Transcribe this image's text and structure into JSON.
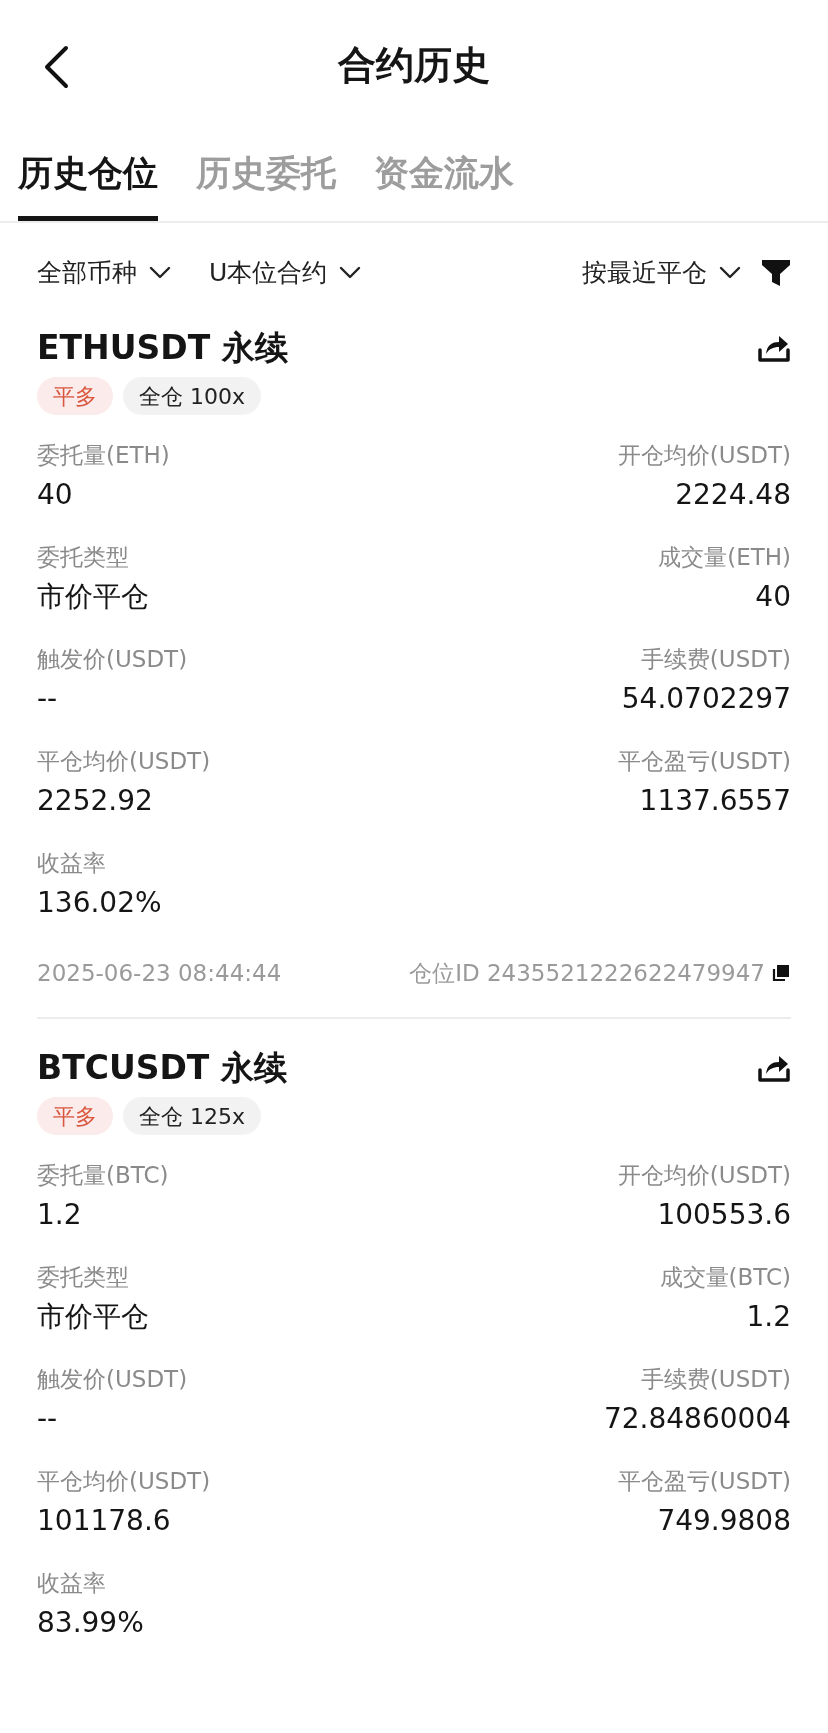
{
  "header": {
    "title": "合约历史"
  },
  "tabs": [
    {
      "label": "历史仓位",
      "selected": true
    },
    {
      "label": "历史委托",
      "selected": false
    },
    {
      "label": "资金流水",
      "selected": false
    }
  ],
  "filters": {
    "left": [
      "全部币种",
      "U本位合约"
    ],
    "sort": "按最近平仓"
  },
  "positions": [
    {
      "symbol": "ETHUSDT 永续",
      "tags": [
        {
          "kind": "side",
          "label": "平多"
        },
        {
          "kind": "margin",
          "label": "全仓 100x"
        }
      ],
      "fields": [
        {
          "label": "委托量(ETH)",
          "value": "40"
        },
        {
          "label": "开仓均价(USDT)",
          "value": "2224.48"
        },
        {
          "label": "委托类型",
          "value": "市价平仓"
        },
        {
          "label": "成交量(ETH)",
          "value": "40"
        },
        {
          "label": "触发价(USDT)",
          "value": "--"
        },
        {
          "label": "手续费(USDT)",
          "value": "54.0702297"
        },
        {
          "label": "平仓均价(USDT)",
          "value": "2252.92"
        },
        {
          "label": "平仓盈亏(USDT)",
          "value": "1137.6557"
        },
        {
          "label": "收益率",
          "value": "136.02%"
        }
      ],
      "time": "2025-06-23 08:44:44",
      "position_id": "仓位ID 2435521222622479947"
    },
    {
      "symbol": "BTCUSDT 永续",
      "tags": [
        {
          "kind": "side",
          "label": "平多"
        },
        {
          "kind": "margin",
          "label": "全仓 125x"
        }
      ],
      "fields": [
        {
          "label": "委托量(BTC)",
          "value": "1.2"
        },
        {
          "label": "开仓均价(USDT)",
          "value": "100553.6"
        },
        {
          "label": "委托类型",
          "value": "市价平仓"
        },
        {
          "label": "成交量(BTC)",
          "value": "1.2"
        },
        {
          "label": "触发价(USDT)",
          "value": "--"
        },
        {
          "label": "手续费(USDT)",
          "value": "72.84860004"
        },
        {
          "label": "平仓均价(USDT)",
          "value": "101178.6"
        },
        {
          "label": "平仓盈亏(USDT)",
          "value": "749.9808"
        },
        {
          "label": "收益率",
          "value": "83.99%"
        }
      ]
    }
  ]
}
